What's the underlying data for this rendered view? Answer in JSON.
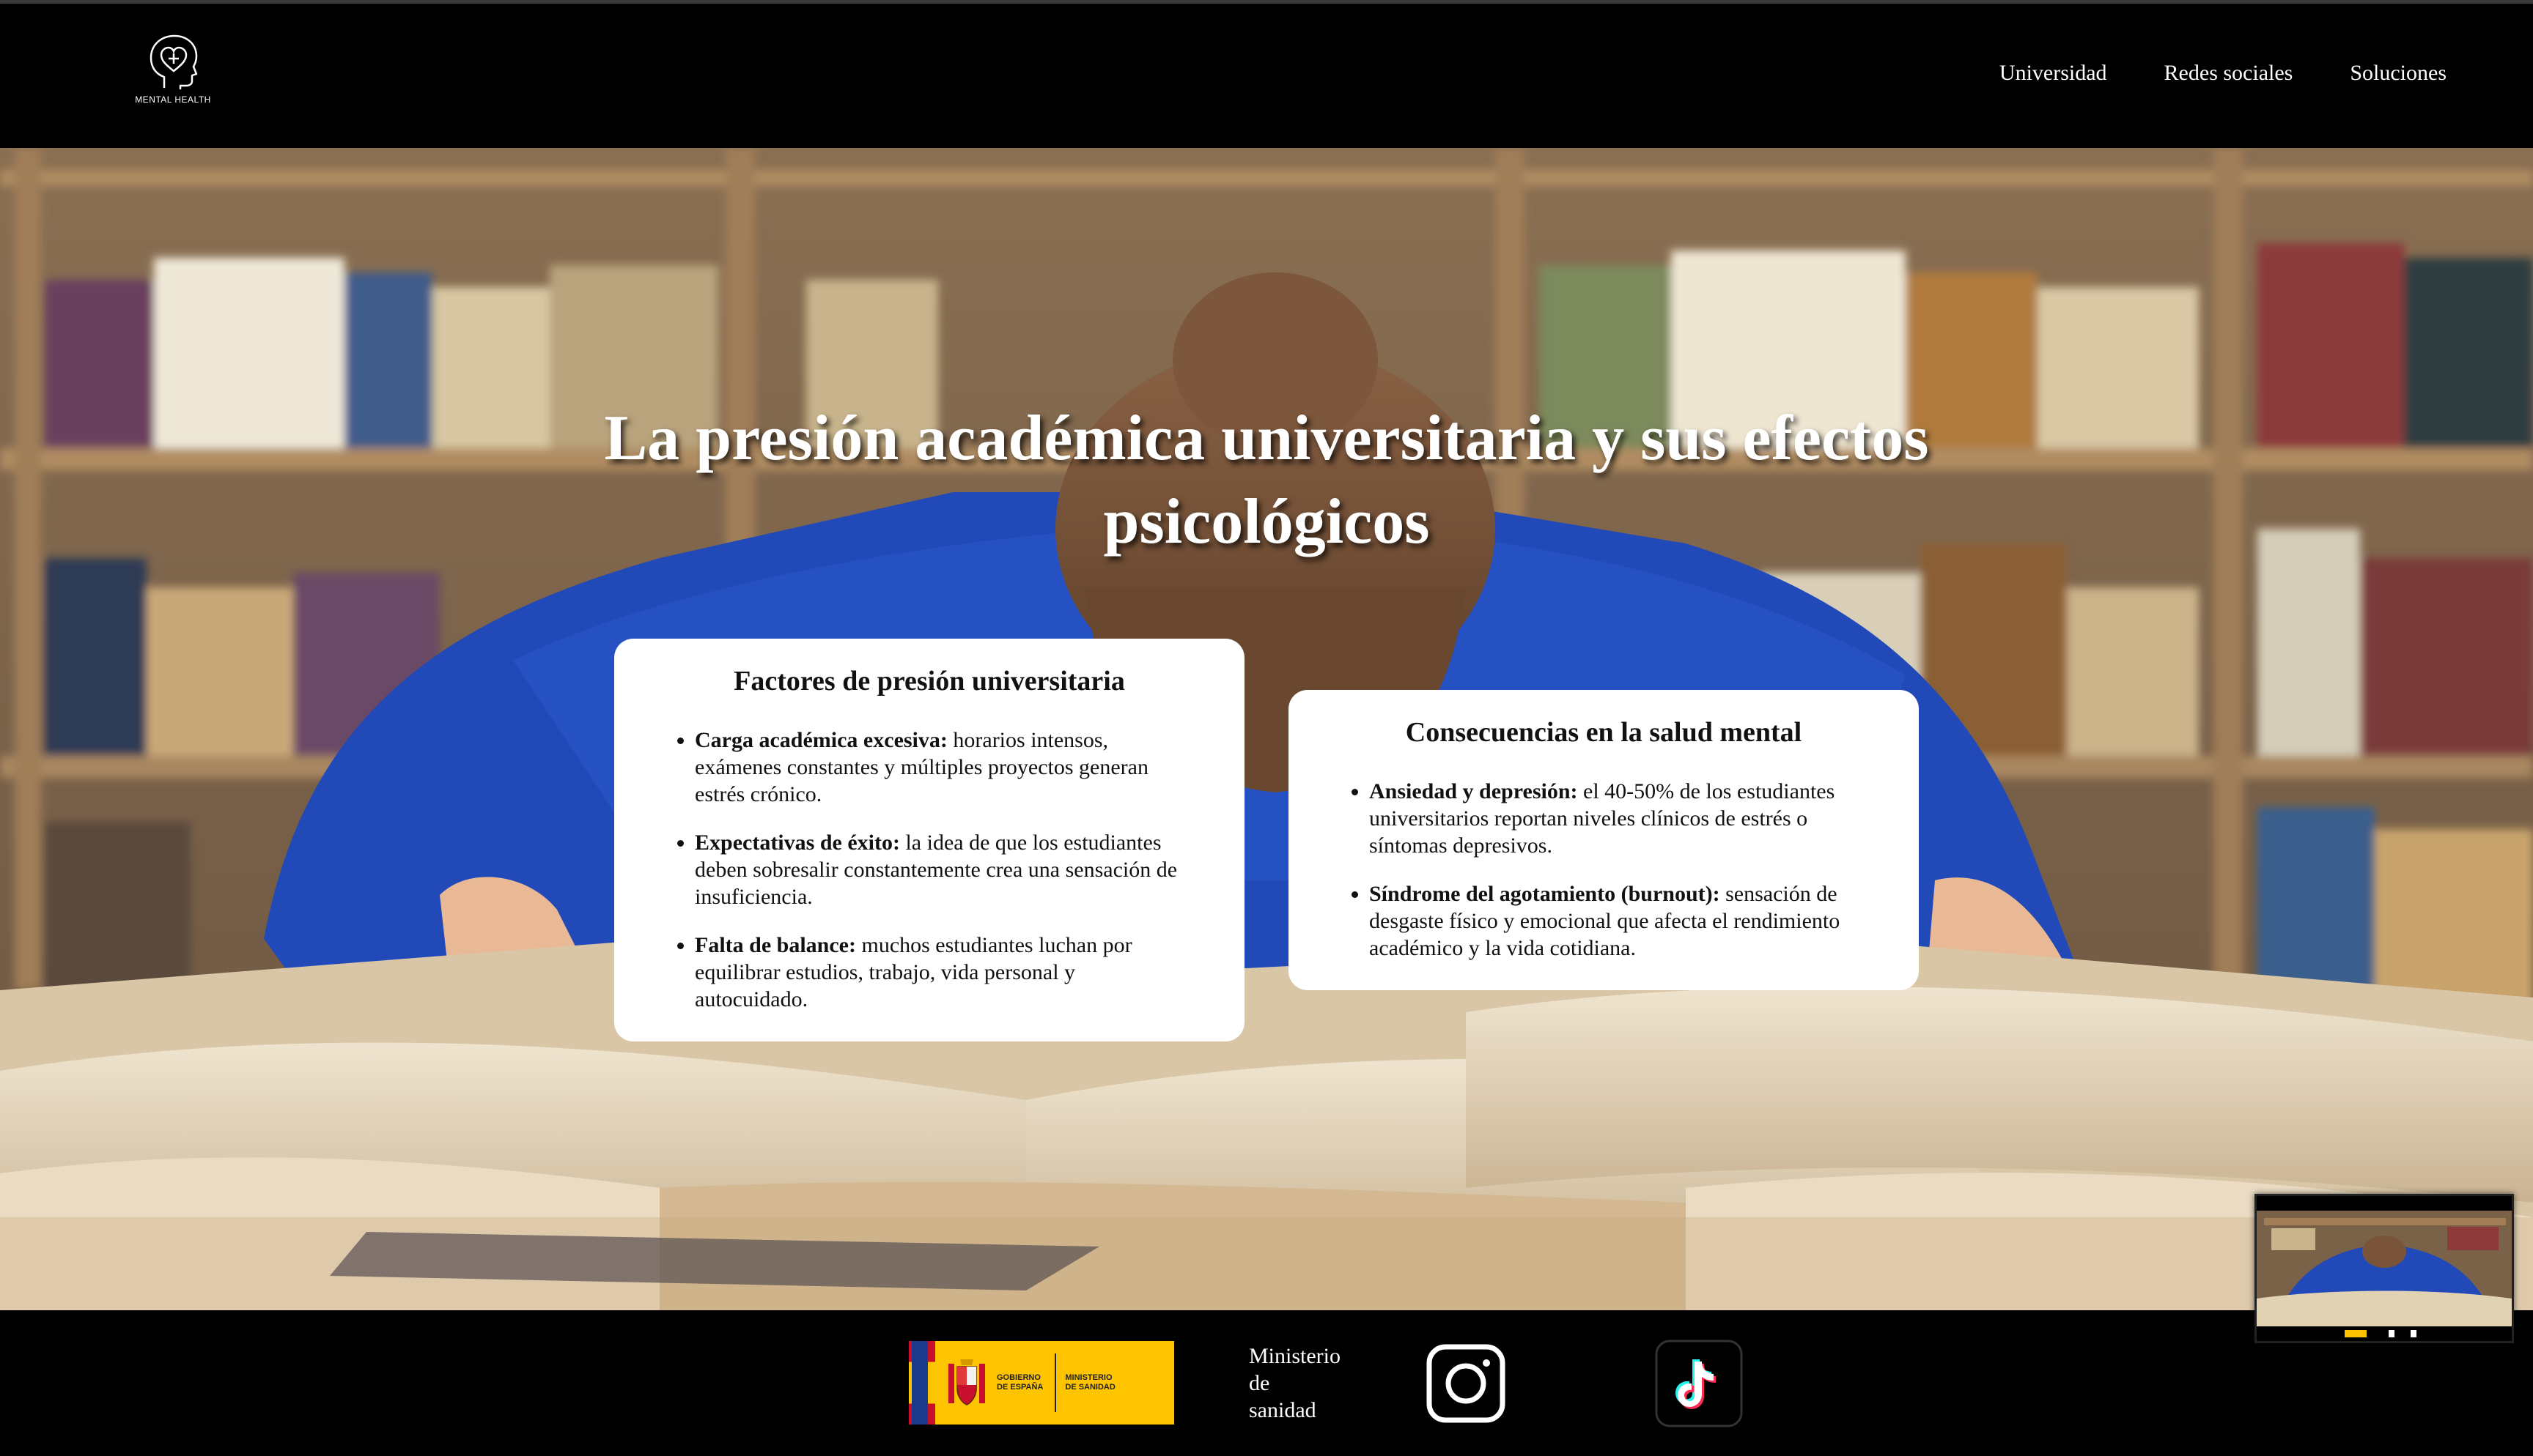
{
  "header": {
    "logo_text": "MENTAL HEALTH",
    "logo_icon": "head-heart-icon",
    "nav": [
      {
        "label": "Universidad"
      },
      {
        "label": "Redes sociales"
      },
      {
        "label": "Soluciones"
      }
    ]
  },
  "hero": {
    "title": "La presión académica universitaria y sus efectos psicológicos",
    "background_image": "student-asleep-on-books-library"
  },
  "cards": {
    "left": {
      "title": "Factores de presión universitaria",
      "items": [
        {
          "term": "Carga académica excesiva:",
          "text": " horarios intensos, exámenes constantes y múltiples proyectos generan estrés crónico."
        },
        {
          "term": "Expectativas de éxito:",
          "text": " la idea de que los estudiantes deben sobresalir constantemente crea una sensación de insuficiencia."
        },
        {
          "term": "Falta de balance:",
          "text": " muchos estudiantes luchan por equilibrar estudios, trabajo, vida personal y autocuidado."
        }
      ]
    },
    "right": {
      "title": "Consecuencias en la salud mental",
      "items": [
        {
          "term": "Ansiedad y depresión:",
          "text": " el 40-50% de los estudiantes universitarios reportan niveles clínicos de estrés o síntomas depresivos."
        },
        {
          "term": "Síndrome del agotamiento (burnout):",
          "text": " sensación de desgaste físico y emocional que afecta el rendimiento académico y la vida cotidiana."
        }
      ]
    }
  },
  "footer": {
    "gov_logo": {
      "line1": "GOBIERNO",
      "line2": "DE ESPAÑA",
      "line3": "MINISTERIO",
      "line4": "DE SANIDAD"
    },
    "ministerio_lines": [
      "Ministerio",
      "de",
      "sanidad"
    ],
    "social": [
      {
        "icon": "instagram-icon"
      },
      {
        "icon": "tiktok-icon"
      }
    ]
  },
  "colors": {
    "background": "#000000",
    "card": "#ffffff",
    "gov_yellow": "#ffc400",
    "spain_red": "#c8102e"
  }
}
